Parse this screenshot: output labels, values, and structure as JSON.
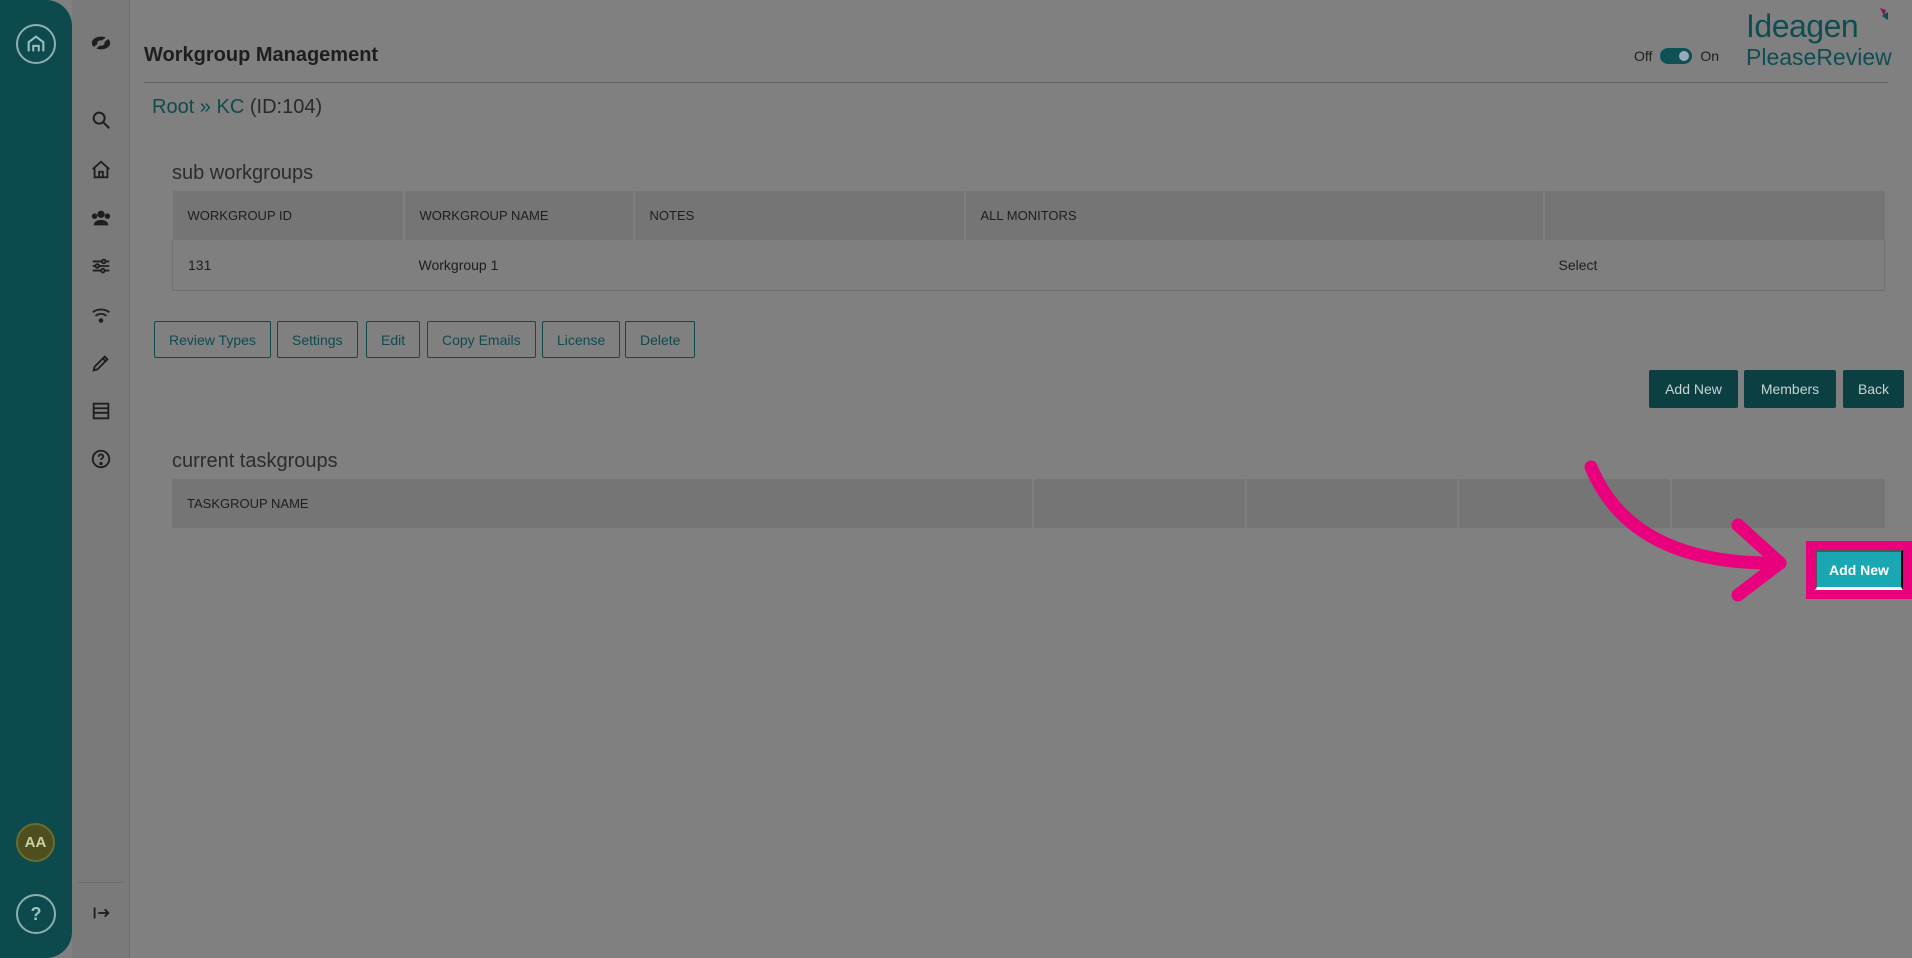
{
  "header": {
    "title": "Workgroup Management",
    "toggle_off": "Off",
    "toggle_on": "On",
    "brand_line1": "Ideagen",
    "brand_line2": "PleaseReview"
  },
  "breadcrumb": {
    "root": "Root",
    "sep": " » ",
    "current": "KC",
    "id": " (ID:104)"
  },
  "rail": {
    "avatar": "AA",
    "help": "?"
  },
  "icons": [
    "home-circle-icon",
    "logo-icon",
    "search-icon",
    "home-icon",
    "users-icon",
    "sliders-icon",
    "wifi-icon",
    "pencil-icon",
    "list-icon",
    "help-circle-icon",
    "collapse-icon"
  ],
  "sub_workgroups": {
    "title": "sub workgroups",
    "columns": [
      "WORKGROUP ID",
      "WORKGROUP NAME",
      "NOTES",
      "ALL MONITORS",
      ""
    ],
    "rows": [
      {
        "id": "131",
        "name": "Workgroup 1",
        "notes": "",
        "monitors": "",
        "action": "Select"
      }
    ]
  },
  "actions": {
    "review_types": "Review Types",
    "settings": "Settings",
    "edit": "Edit",
    "copy_emails": "Copy Emails",
    "license": "License",
    "delete": "Delete"
  },
  "workgroup_buttons": {
    "add_new": "Add New",
    "members": "Members",
    "back": "Back"
  },
  "taskgroups": {
    "title": "current taskgroups",
    "columns": [
      "TASKGROUP NAME",
      "",
      "",
      "",
      ""
    ],
    "add_new": "Add New"
  },
  "colors": {
    "rail": "#0d4a4d",
    "accent": "#1aa7b4",
    "highlight": "#e8007d"
  }
}
